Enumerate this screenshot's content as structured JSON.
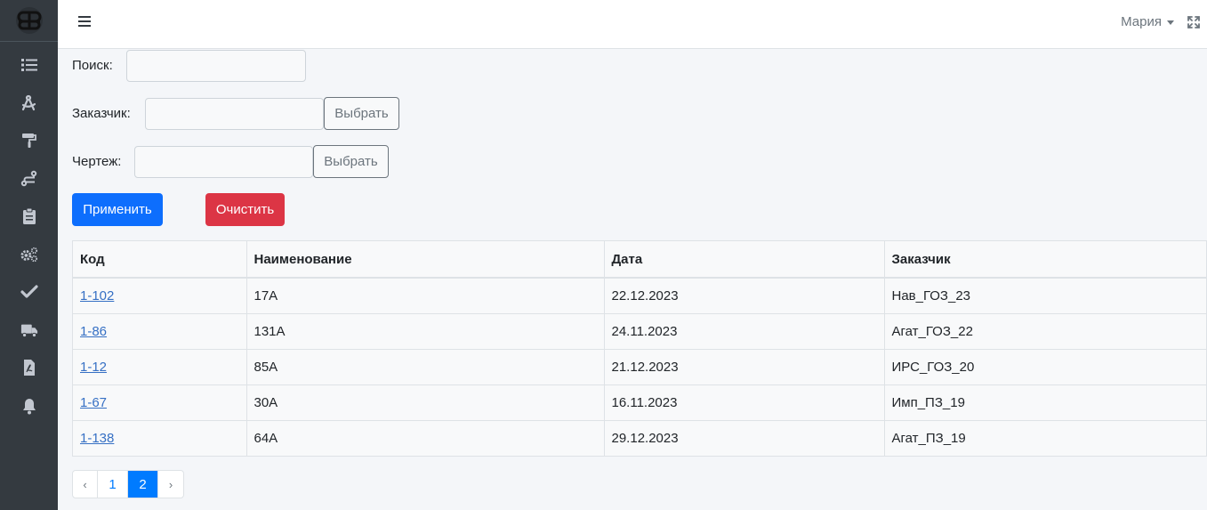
{
  "header": {
    "user_name": "Мария"
  },
  "sidebar": {
    "items": [
      {
        "icon": "list-icon"
      },
      {
        "icon": "drafting-compass-icon"
      },
      {
        "icon": "paint-roller-icon"
      },
      {
        "icon": "route-icon"
      },
      {
        "icon": "clipboard-icon"
      },
      {
        "icon": "cogs-icon"
      },
      {
        "icon": "check-icon"
      },
      {
        "icon": "truck-icon"
      },
      {
        "icon": "file-pdf-icon"
      },
      {
        "icon": "bell-icon"
      }
    ]
  },
  "filters": {
    "search_label": "Поиск:",
    "search_value": "",
    "customer_label": "Заказчик:",
    "customer_value": "",
    "drawing_label": "Чертеж:",
    "drawing_value": "",
    "select_label": "Выбрать",
    "apply_label": "Применить",
    "clear_label": "Очистить"
  },
  "table": {
    "columns": [
      "Код",
      "Наименование",
      "Дата",
      "Заказчик"
    ],
    "rows": [
      {
        "code": "1-102",
        "name": "17А",
        "date": "22.12.2023",
        "customer": "Нав_ГОЗ_23"
      },
      {
        "code": "1-86",
        "name": "131А",
        "date": "24.11.2023",
        "customer": "Агат_ГОЗ_22"
      },
      {
        "code": "1-12",
        "name": "85А",
        "date": "21.12.2023",
        "customer": "ИРС_ГОЗ_20"
      },
      {
        "code": "1-67",
        "name": "30А",
        "date": "16.11.2023",
        "customer": "Имп_ПЗ_19"
      },
      {
        "code": "1-138",
        "name": "64А",
        "date": "29.12.2023",
        "customer": "Агат_ПЗ_19"
      }
    ]
  },
  "pagination": {
    "prev": "‹",
    "pages": [
      "1",
      "2"
    ],
    "active_page": "2",
    "next": "›"
  },
  "colors": {
    "sidebar_bg": "#343a40",
    "primary": "#0d6efd",
    "danger": "#dc3545",
    "link": "#3670c4"
  }
}
